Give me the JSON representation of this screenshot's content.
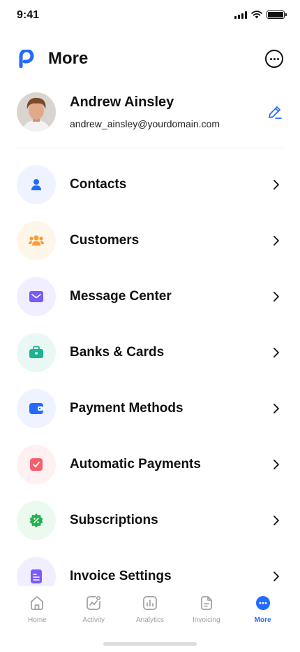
{
  "status_bar": {
    "time": "9:41"
  },
  "header": {
    "title": "More"
  },
  "profile": {
    "name": "Andrew Ainsley",
    "email": "andrew_ainsley@yourdomain.com"
  },
  "menu": [
    {
      "label": "Contacts",
      "icon": "person-icon",
      "bg": "#eef3ff",
      "color": "#246bfd"
    },
    {
      "label": "Customers",
      "icon": "people-icon",
      "bg": "#fff6ea",
      "color": "#ff9b2f"
    },
    {
      "label": "Message Center",
      "icon": "mail-icon",
      "bg": "#f1efff",
      "color": "#7a5af8"
    },
    {
      "label": "Banks & Cards",
      "icon": "briefcase-icon",
      "bg": "#eaf8f5",
      "color": "#1ab394"
    },
    {
      "label": "Payment Methods",
      "icon": "wallet-icon",
      "bg": "#eef3ff",
      "color": "#246bfd"
    },
    {
      "label": "Automatic Payments",
      "icon": "checkbox-icon",
      "bg": "#fff0f1",
      "color": "#f75e6e"
    },
    {
      "label": "Subscriptions",
      "icon": "discount-badge-icon",
      "bg": "#ebf9ef",
      "color": "#22b24c"
    },
    {
      "label": "Invoice Settings",
      "icon": "document-icon",
      "bg": "#f1efff",
      "color": "#7a5af8"
    }
  ],
  "tabs": [
    {
      "label": "Home",
      "icon": "home-icon",
      "active": false
    },
    {
      "label": "Activity",
      "icon": "activity-icon",
      "active": false
    },
    {
      "label": "Analytics",
      "icon": "analytics-icon",
      "active": false
    },
    {
      "label": "Invoicing",
      "icon": "invoice-icon",
      "active": false
    },
    {
      "label": "More",
      "icon": "more-icon",
      "active": true
    }
  ],
  "colors": {
    "accent": "#246bfd",
    "inactive": "#9e9e9e"
  }
}
